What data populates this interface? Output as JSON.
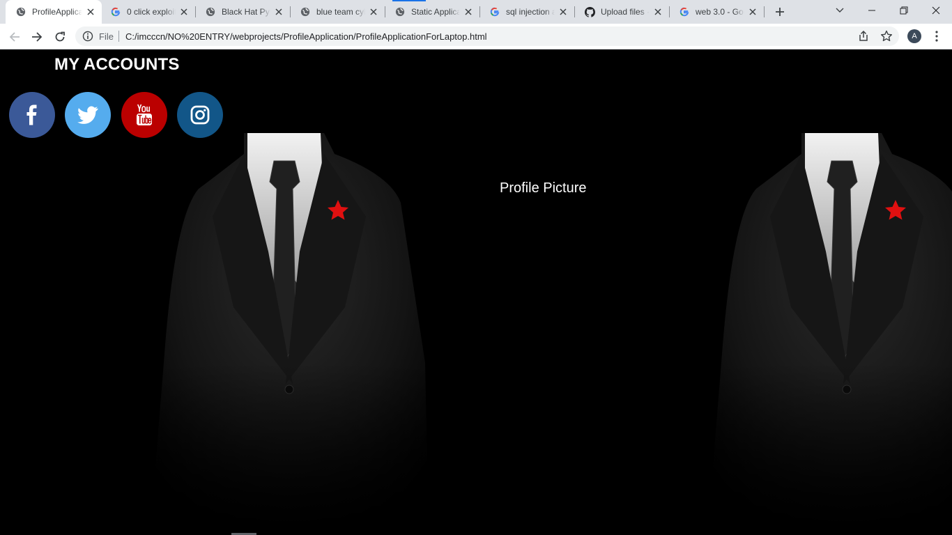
{
  "browser": {
    "tabs": [
      {
        "title": "ProfileApplica",
        "favicon": "globe-icon",
        "active": true
      },
      {
        "title": "0 click exploit",
        "favicon": "google-icon",
        "active": false
      },
      {
        "title": "Black Hat Pyth",
        "favicon": "globe-icon",
        "active": false
      },
      {
        "title": "blue team cyb",
        "favicon": "globe-icon",
        "active": false
      },
      {
        "title": "Static Applica",
        "favicon": "globe-icon",
        "active": false
      },
      {
        "title": "sql injection a",
        "favicon": "google-icon",
        "active": false
      },
      {
        "title": "Upload files ·",
        "favicon": "github-icon",
        "active": false
      },
      {
        "title": "web 3.0 - Goo",
        "favicon": "google-icon",
        "active": false
      }
    ],
    "omnibox": {
      "scheme_label": "File",
      "url": "C:/imcccn/NO%20ENTRY/webprojects/ProfileApplication/ProfileApplicationForLaptop.html"
    },
    "profile_initial": "A"
  },
  "page": {
    "heading": "MY ACCOUNTS",
    "social_links": [
      {
        "name": "facebook",
        "color": "#3b5998"
      },
      {
        "name": "twitter",
        "color": "#55acee"
      },
      {
        "name": "youtube",
        "color": "#bb0000"
      },
      {
        "name": "instagram",
        "color": "#125688"
      }
    ],
    "profile_caption": "Profile Picture"
  }
}
